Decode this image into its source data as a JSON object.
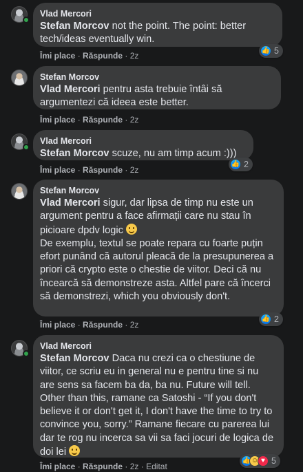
{
  "labels": {
    "like": "Îmi place",
    "reply": "Răspunde",
    "sep": "·",
    "edited": "Editat"
  },
  "comments": [
    {
      "author": "Vlad Mercori",
      "mention": "Stefan Morcov",
      "text": " not the point. The point: better tech/ideas eventually win.",
      "time": "2z",
      "reaction_count": "5",
      "reactions": [
        "like"
      ]
    },
    {
      "author": "Stefan Morcov",
      "mention": "Vlad Mercori",
      "text": " pentru asta trebuie întâi să argumentezi că ideea este better.",
      "time": "2z"
    },
    {
      "author": "Vlad Mercori",
      "mention": "Stefan Morcov",
      "text": " scuze, nu am timp acum :)))",
      "time": "2z",
      "reaction_count": "2",
      "reactions": [
        "like"
      ]
    },
    {
      "author": "Stefan Morcov",
      "mention": "Vlad Mercori",
      "text": " sigur, dar lipsa de timp nu este un argument pentru a face afirmații care nu stau în picioare dpdv logic",
      "text2": "De exemplu, textul se poate repara cu foarte puțin efort punând că autorul pleacă de la presupunerea a priori că crypto este o chestie de viitor. Deci că nu încearcă să demonstreze asta. Altfel pare că încerci să demonstrezi, which you obviously don't.",
      "time": "2z",
      "reaction_count": "2",
      "reactions": [
        "like"
      ]
    },
    {
      "author": "Vlad Mercori",
      "mention": "Stefan Morcov",
      "text": " Daca nu crezi ca o chestiune de viitor, ce scriu eu in general nu e pentru tine si nu are sens sa facem ba da, ba nu. Future will tell. Other than this, ramane ca Satoshi - “If you don't believe it or don't get it, I don't have the time to try to convince you, sorry.” Ramane fiecare cu parerea lui dar te rog nu incerca sa vii sa faci jocuri de logica de doi lei",
      "time": "2z",
      "edited": true,
      "reaction_count": "5",
      "reactions": [
        "like",
        "haha",
        "love"
      ]
    }
  ]
}
